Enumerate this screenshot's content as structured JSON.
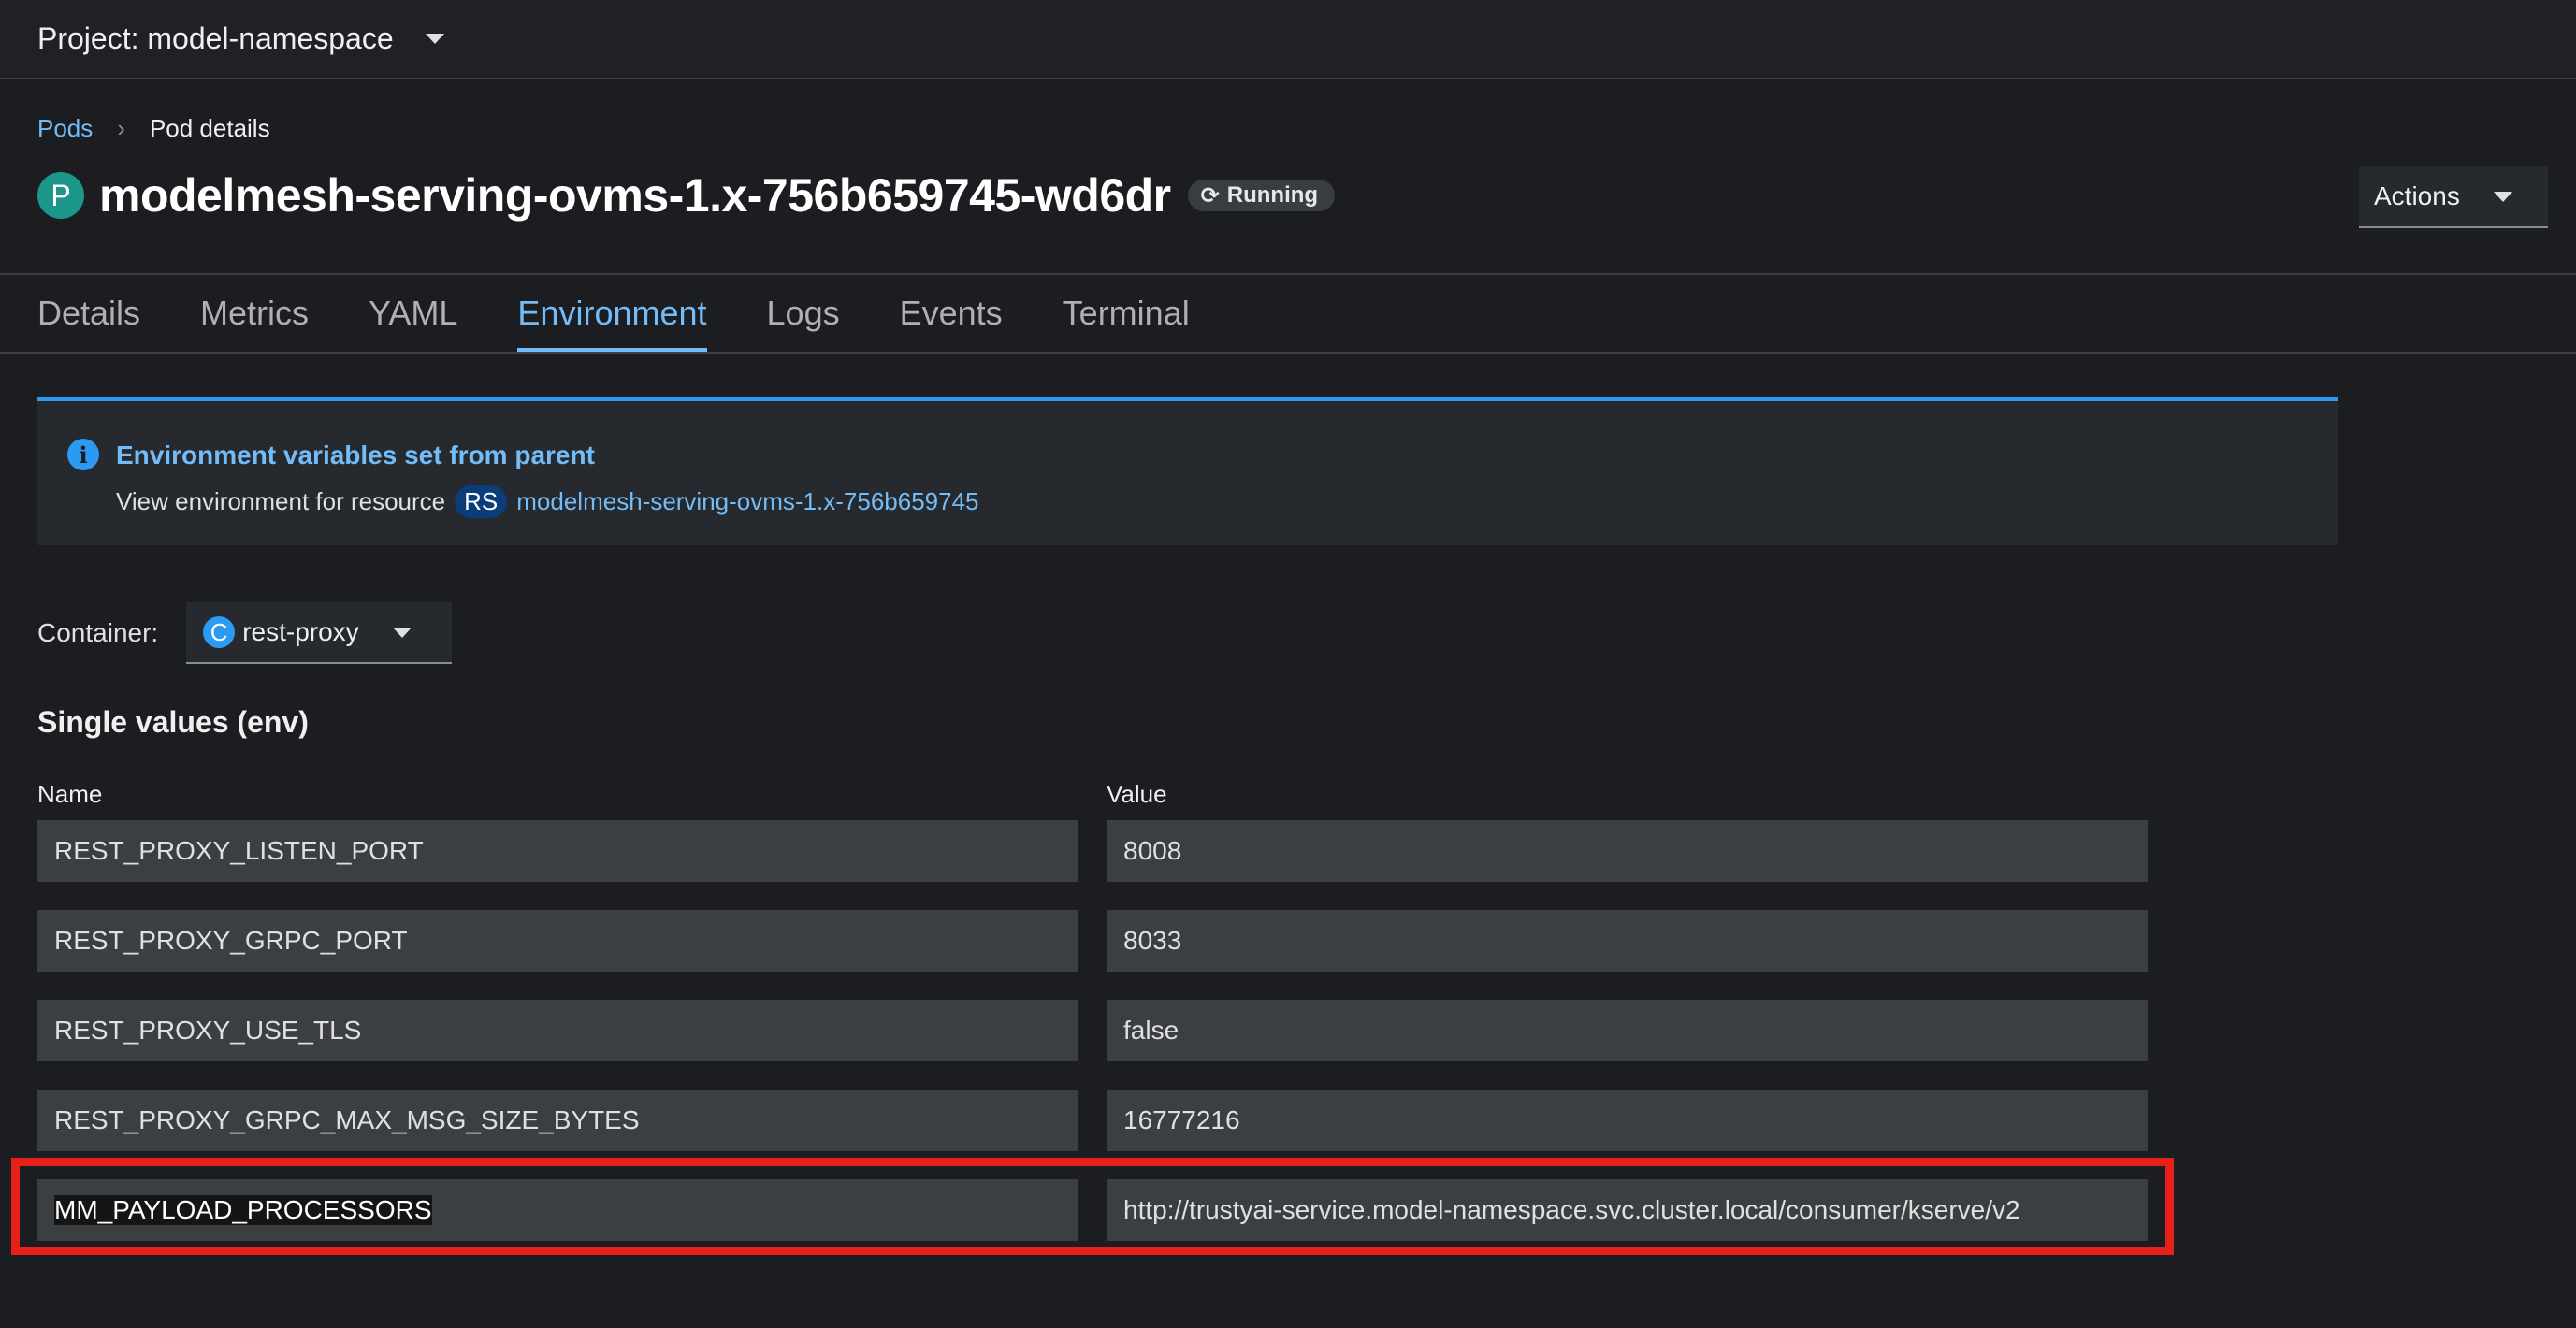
{
  "topbar": {
    "project_label": "Project: model-namespace"
  },
  "breadcrumb": {
    "parent": "Pods",
    "current": "Pod details"
  },
  "header": {
    "resource_badge": "P",
    "title": "modelmesh-serving-ovms-1.x-756b659745-wd6dr",
    "status_icon": "sync-icon",
    "status": "Running",
    "actions_label": "Actions"
  },
  "tabs": [
    {
      "label": "Details"
    },
    {
      "label": "Metrics"
    },
    {
      "label": "YAML"
    },
    {
      "label": "Environment",
      "active": true
    },
    {
      "label": "Logs"
    },
    {
      "label": "Events"
    },
    {
      "label": "Terminal"
    }
  ],
  "alert": {
    "icon": "info-icon",
    "title": "Environment variables set from parent",
    "body_text": "View environment for resource",
    "resource_badge": "RS",
    "resource_link": "modelmesh-serving-ovms-1.x-756b659745"
  },
  "container": {
    "label": "Container:",
    "badge": "C",
    "selected": "rest-proxy"
  },
  "env_section": {
    "title": "Single values (env)",
    "name_header": "Name",
    "value_header": "Value",
    "rows": [
      {
        "name": "REST_PROXY_LISTEN_PORT",
        "value": "8008"
      },
      {
        "name": "REST_PROXY_GRPC_PORT",
        "value": "8033"
      },
      {
        "name": "REST_PROXY_USE_TLS",
        "value": "false"
      },
      {
        "name": "REST_PROXY_GRPC_MAX_MSG_SIZE_BYTES",
        "value": "16777216"
      },
      {
        "name": "MM_PAYLOAD_PROCESSORS",
        "value": "http://trustyai-service.model-namespace.svc.cluster.local/consumer/kserve/v2"
      }
    ]
  },
  "colors": {
    "accent": "#73bcf7",
    "highlight": "#e8201a",
    "status_badge": "#1c968a"
  }
}
